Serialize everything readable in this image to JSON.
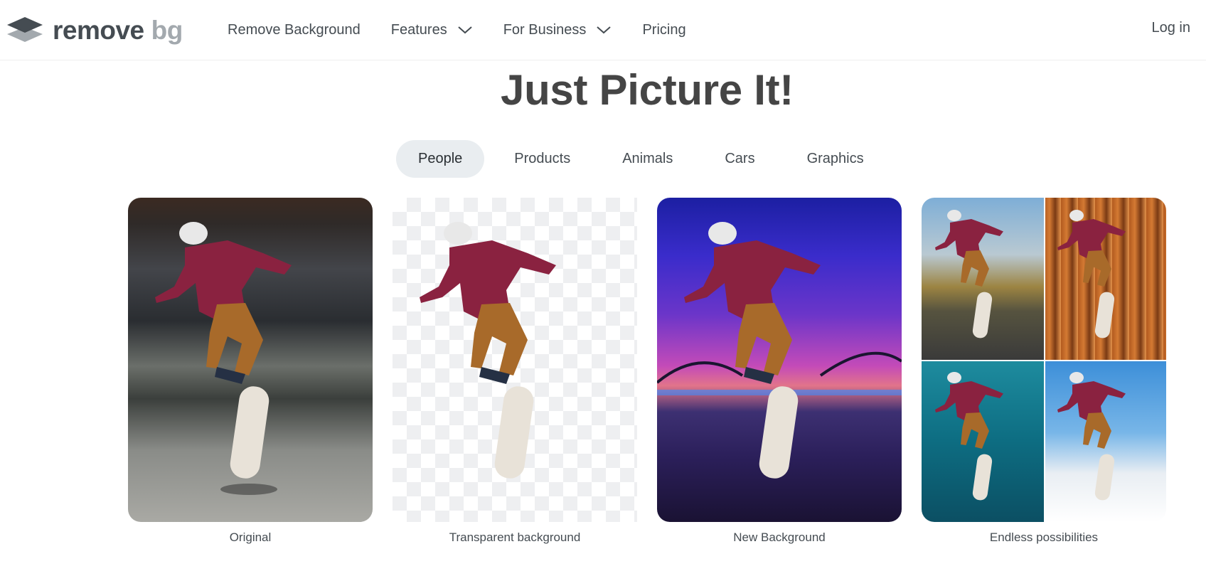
{
  "header": {
    "logo": {
      "word1": "remove",
      "word2": "bg"
    },
    "nav": [
      {
        "label": "Remove Background",
        "has_dropdown": false
      },
      {
        "label": "Features",
        "has_dropdown": true
      },
      {
        "label": "For Business",
        "has_dropdown": true
      },
      {
        "label": "Pricing",
        "has_dropdown": false
      }
    ],
    "login_label": "Log in"
  },
  "headline": "Just Picture It!",
  "tabs": [
    {
      "label": "People",
      "active": true
    },
    {
      "label": "Products",
      "active": false
    },
    {
      "label": "Animals",
      "active": false
    },
    {
      "label": "Cars",
      "active": false
    },
    {
      "label": "Graphics",
      "active": false
    }
  ],
  "cards": [
    {
      "caption": "Original"
    },
    {
      "caption": "Transparent background"
    },
    {
      "caption": "New Background"
    },
    {
      "caption": "Endless possibilities"
    }
  ],
  "colors": {
    "text": "#454c52",
    "active_tab_bg": "#e9edf0",
    "logo_remove": "#454c52",
    "logo_bg": "#a3a9ae"
  }
}
